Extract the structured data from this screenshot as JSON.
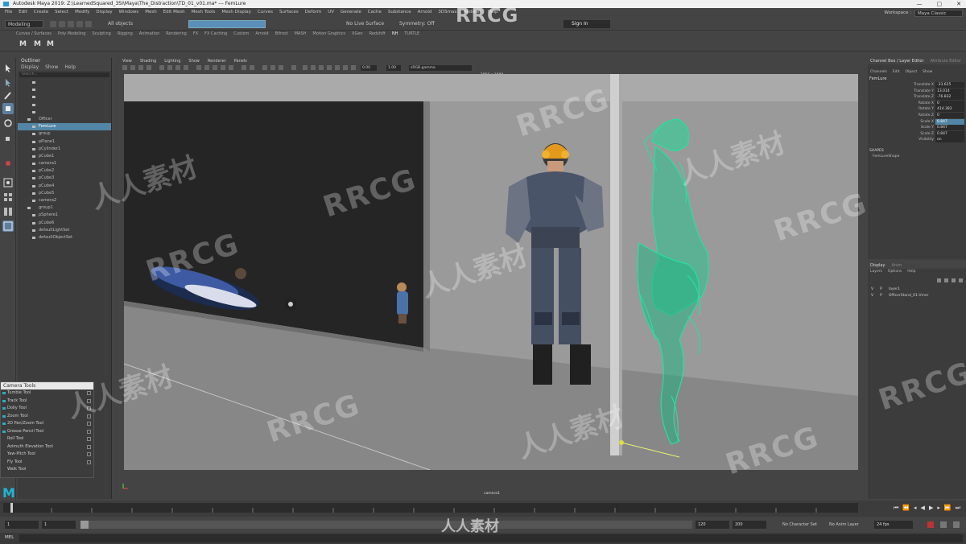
{
  "window": {
    "title": "Autodesk Maya 2019: Z:\\LearnedSquared_3SI\\Maya\\The_Distraction\\TD_01_v01.ma*  ---  FemLure",
    "controls": [
      "—",
      "▢",
      "✕"
    ]
  },
  "menubar": {
    "items": [
      "File",
      "Edit",
      "Create",
      "Select",
      "Modify",
      "Display",
      "Windows",
      "Mesh",
      "Edit Mesh",
      "Mesh Tools",
      "Mesh Display",
      "Curves",
      "Surfaces",
      "Deform",
      "UV",
      "Generate",
      "Cache",
      "Substance",
      "Arnold",
      "3DSmax",
      "Redshift",
      "Help"
    ],
    "workspace_label": "Workspace :",
    "workspace_value": "Maya Classic"
  },
  "statusline": {
    "mode": "Modeling",
    "select_filter": "All objects",
    "live_surface": "No Live Surface",
    "symmetry": "Symmetry: Off",
    "sign_in": "Sign In"
  },
  "shelf": {
    "tabs": [
      "Curves / Surfaces",
      "Poly Modeling",
      "Sculpting",
      "Rigging",
      "Animation",
      "Rendering",
      "FX",
      "FX Caching",
      "Custom",
      "Arnold",
      "Bifrost",
      "MASH",
      "Motion Graphics",
      "XGen",
      "Redshift",
      "NH",
      "TURTLE"
    ],
    "active_tab": "NH",
    "icons": [
      "M",
      "M",
      "M"
    ]
  },
  "outliner": {
    "title": "Outliner",
    "menu": [
      "Display",
      "Show",
      "Help"
    ],
    "search_placeholder": "Search...",
    "items": [
      {
        "label": "",
        "selected": false
      },
      {
        "label": "",
        "selected": false
      },
      {
        "label": "",
        "selected": false
      },
      {
        "label": "",
        "selected": false
      },
      {
        "label": "",
        "selected": false
      },
      {
        "label": "Officer",
        "selected": false
      },
      {
        "label": "FemLure",
        "selected": true
      },
      {
        "label": "group",
        "selected": false
      },
      {
        "label": "pPlane1",
        "selected": false
      },
      {
        "label": "pCylinder1",
        "selected": false
      },
      {
        "label": "pCube1",
        "selected": false
      },
      {
        "label": "camera1",
        "selected": false
      },
      {
        "label": "pCube2",
        "selected": false
      },
      {
        "label": "pCube3",
        "selected": false
      },
      {
        "label": "pCube4",
        "selected": false
      },
      {
        "label": "pCube5",
        "selected": false
      },
      {
        "label": "camera2",
        "selected": false
      },
      {
        "label": "group1",
        "selected": false
      },
      {
        "label": "pSphere1",
        "selected": false
      },
      {
        "label": "pCube6",
        "selected": false
      },
      {
        "label": "defaultLightSet",
        "selected": false
      },
      {
        "label": "defaultObjectSet",
        "selected": false
      }
    ]
  },
  "camera_tools": {
    "title": "Camera Tools",
    "items": [
      "Tumble Tool",
      "Track Tool",
      "Dolly Tool",
      "Zoom Tool",
      "2D Pan/Zoom Tool",
      "Grease Pencil Tool",
      "Roll Tool",
      "Azimuth Elevation Tool",
      "Yaw-Pitch Tool",
      "Fly Tool",
      "Walk Tool"
    ]
  },
  "viewport": {
    "menu": [
      "View",
      "Shading",
      "Lighting",
      "Show",
      "Renderer",
      "Panels"
    ],
    "field_a": "0.00",
    "field_b": "1.00",
    "colorspace": "sRGB gamma",
    "resolution_label": "2850 x 1600",
    "camera_label": "camera1"
  },
  "channel_box": {
    "tabs": [
      "Channel Box / Layer Editor",
      "Attribute Editor"
    ],
    "menu": [
      "Channels",
      "Edit",
      "Object",
      "Show"
    ],
    "object": "FemLure",
    "attributes": [
      {
        "name": "Translate X",
        "value": "-33.625",
        "highlight": false
      },
      {
        "name": "Translate Y",
        "value": "13.014",
        "highlight": false
      },
      {
        "name": "Translate Z",
        "value": "-76.832",
        "highlight": false
      },
      {
        "name": "Rotate X",
        "value": "0",
        "highlight": false
      },
      {
        "name": "Rotate Y",
        "value": "414.383",
        "highlight": false
      },
      {
        "name": "Rotate Z",
        "value": "0",
        "highlight": false
      },
      {
        "name": "Scale X",
        "value": "0.847",
        "highlight": true
      },
      {
        "name": "Scale Y",
        "value": "0.847",
        "highlight": false
      },
      {
        "name": "Scale Z",
        "value": "0.847",
        "highlight": false
      },
      {
        "name": "Visibility",
        "value": "on",
        "highlight": false
      }
    ],
    "shapes_label": "SHAPES",
    "shape_name": "FemLureShape"
  },
  "layer_editor": {
    "tabs": [
      "Display",
      "Anim"
    ],
    "menu": [
      "Layers",
      "Options",
      "Help"
    ],
    "layers": [
      {
        "v": "V",
        "p": "P",
        "name": "layer1"
      },
      {
        "v": "V",
        "p": "P",
        "name": "OfficerStand_01:Vmer"
      }
    ]
  },
  "time": {
    "range_start": "1",
    "range_start_inner": "1",
    "range_end_inner": "120",
    "range_end": "200",
    "character_set": "No Character Set",
    "anim_layer": "No Anim Layer",
    "fps": "24 fps"
  },
  "command_line": {
    "label": "MEL"
  },
  "watermarks": {
    "rrcg": "RRCG",
    "cn": "人人素材",
    "bottom": "人人素材"
  }
}
